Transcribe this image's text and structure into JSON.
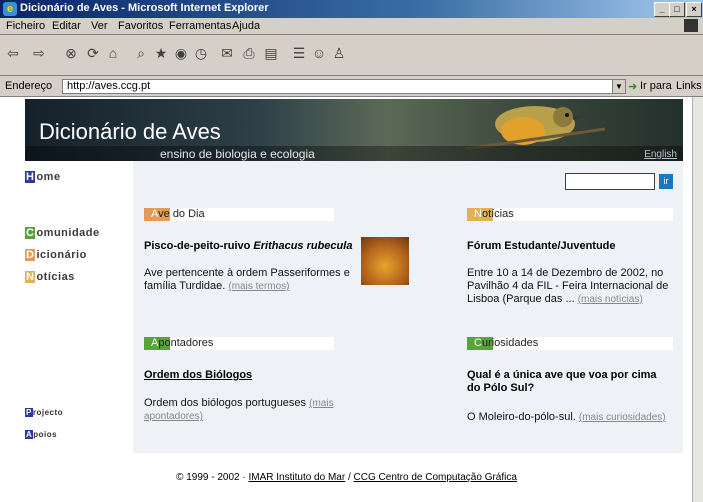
{
  "window": {
    "title": "Dicionário de Aves - Microsoft Internet Explorer",
    "minimize": "_",
    "maximize": "□",
    "close": "×"
  },
  "menubar": {
    "items": [
      "Ficheiro",
      "Editar",
      "Ver",
      "Favoritos",
      "Ferramentas",
      "Ajuda"
    ]
  },
  "addressbar": {
    "label": "Endereço",
    "url": "http://aves.ccg.pt",
    "go_label": "Ir para",
    "links_label": "Links"
  },
  "banner": {
    "title": "Dicionário de Aves",
    "subtitle": "ensino de biologia e ecologia",
    "lang_link": "English"
  },
  "nav": {
    "home": {
      "initial": "H",
      "rest": "ome"
    },
    "comunidade": {
      "initial": "C",
      "rest": "omunidade"
    },
    "dicionario": {
      "initial": "D",
      "rest": "icionário"
    },
    "noticias": {
      "initial": "N",
      "rest": "otícias"
    },
    "projecto": {
      "initial": "P",
      "rest": "rojecto"
    },
    "apoios": {
      "initial": "A",
      "rest": "poios"
    }
  },
  "search": {
    "button": "ir"
  },
  "sections": {
    "ave_do_dia": {
      "initial": "A",
      "rest": "ve do Dia",
      "title_plain": "Pisco-de-peito-ruivo ",
      "title_italic": "Erithacus rubecula",
      "text": "Ave pertencente à ordem Passeriformes e família Turdidae.",
      "more": "(mais termos)"
    },
    "noticias": {
      "initial": "N",
      "rest": "otícias",
      "title": "Fórum Estudante/Juventude",
      "text": "Entre 10 a 14 de Dezembro de 2002, no Pavilhão 4 da FIL - Feira Internacional de Lisboa (Parque das ...",
      "more": "(mais notícias)"
    },
    "apontadores": {
      "initial": "A",
      "rest": "pontadores",
      "title": "Ordem dos Biólogos",
      "text": "Ordem dos biólogos portugueses",
      "more": "(mais apontadores)"
    },
    "curiosidades": {
      "initial": "C",
      "rest": "uriosidades",
      "title": "Qual é a única ave que voa por cima do Pólo Sul?",
      "text": "O Moleiro-do-pólo-sul.",
      "more": "(mais curiosidades)"
    }
  },
  "footer": {
    "copyright": "© 1999 - 2002 · ",
    "imar": "IMAR Instituto do Mar",
    "sep": " / ",
    "ccg": "CCG Centro de Computação Gráfica"
  },
  "colors": {
    "orange": "#e39b55",
    "green": "#5aa33c",
    "nav_blue": "#2b3a9a",
    "content_bg": "#eef1f5"
  }
}
